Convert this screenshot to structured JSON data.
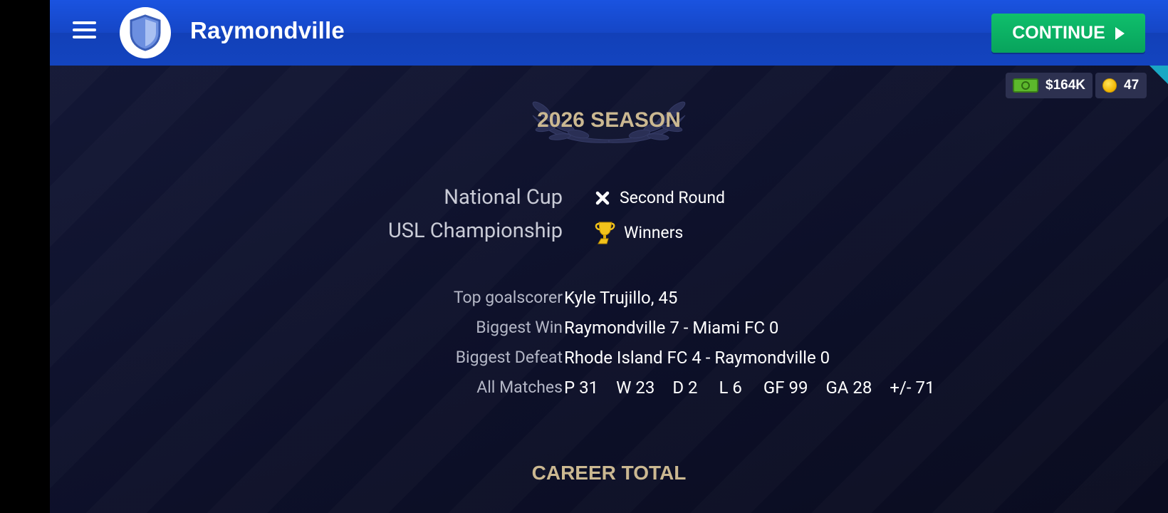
{
  "header": {
    "team_name": "Raymondville",
    "continue_label": "CONTINUE"
  },
  "currency": {
    "money": "$164K",
    "coins": "47"
  },
  "season": {
    "title": "2026 SEASON",
    "competitions": [
      {
        "name": "National Cup",
        "icon": "cross-icon",
        "result": "Second Round"
      },
      {
        "name": "USL Championship",
        "icon": "trophy-icon",
        "result": "Winners"
      }
    ],
    "details": [
      {
        "label": "Top goalscorer",
        "value": "Kyle Trujillo, 45"
      },
      {
        "label": "Biggest Win",
        "value": "Raymondville 7 - Miami FC 0"
      },
      {
        "label": "Biggest Defeat",
        "value": "Rhode Island FC 4 - Raymondville 0"
      }
    ],
    "all_matches": {
      "label": "All Matches",
      "stats": [
        "P 31",
        "W 23",
        "D 2",
        "L 6",
        "GF 99",
        "GA 28",
        "+/- 71"
      ]
    }
  },
  "career": {
    "title": "CAREER TOTAL"
  },
  "colors": {
    "header_blue": "#1546c6",
    "continue_green": "#0fbf6c",
    "gold_title": "#cbb891",
    "background": "#0d1029"
  }
}
